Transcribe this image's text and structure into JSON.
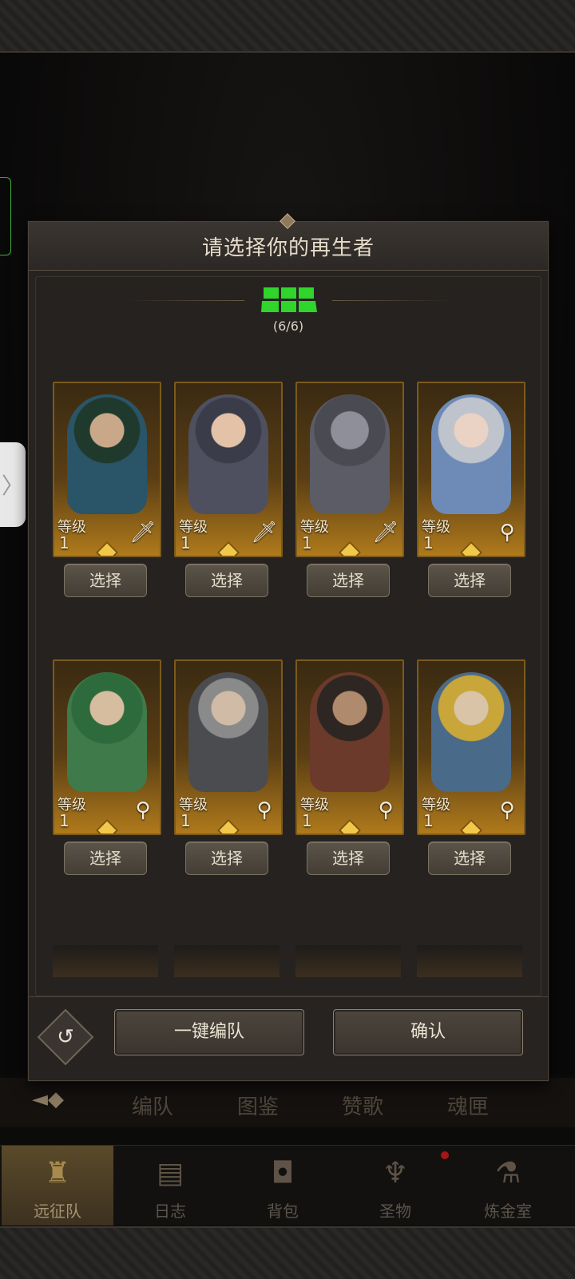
{
  "modal": {
    "title": "请选择你的再生者",
    "team_count": "(6/6)",
    "level_label": "等级",
    "select_label": "选择",
    "auto_team_label": "一键编队",
    "confirm_label": "确认",
    "colors": {
      "team_slot_active": "#2fd52a",
      "portrait_frame": "#7c5a1c"
    }
  },
  "heroes": [
    {
      "level": "1",
      "class_icon": "sword-icon",
      "theme": "#2a5468"
    },
    {
      "level": "1",
      "class_icon": "sword-icon",
      "theme": "#4e5060"
    },
    {
      "level": "1",
      "class_icon": "sword-icon",
      "theme": "#5c5c66"
    },
    {
      "level": "1",
      "class_icon": "staff-icon",
      "theme": "#6d8bb6"
    },
    {
      "level": "1",
      "class_icon": "staff-icon",
      "theme": "#3f7a4a"
    },
    {
      "level": "1",
      "class_icon": "staff-icon",
      "theme": "#4a4c50"
    },
    {
      "level": "1",
      "class_icon": "staff-icon",
      "theme": "#6b3a2a"
    },
    {
      "level": "1",
      "class_icon": "staff-icon",
      "theme": "#c8a63a"
    }
  ],
  "tabs": [
    "编队",
    "图鉴",
    "赞歌",
    "魂匣"
  ],
  "nav": [
    {
      "label": "远征队",
      "icon": "helmet-icon",
      "active": true
    },
    {
      "label": "日志",
      "icon": "scroll-icon",
      "active": false
    },
    {
      "label": "背包",
      "icon": "bag-icon",
      "active": false
    },
    {
      "label": "圣物",
      "icon": "relic-icon",
      "active": false
    },
    {
      "label": "炼金室",
      "icon": "alchemy-icon",
      "active": false
    }
  ]
}
